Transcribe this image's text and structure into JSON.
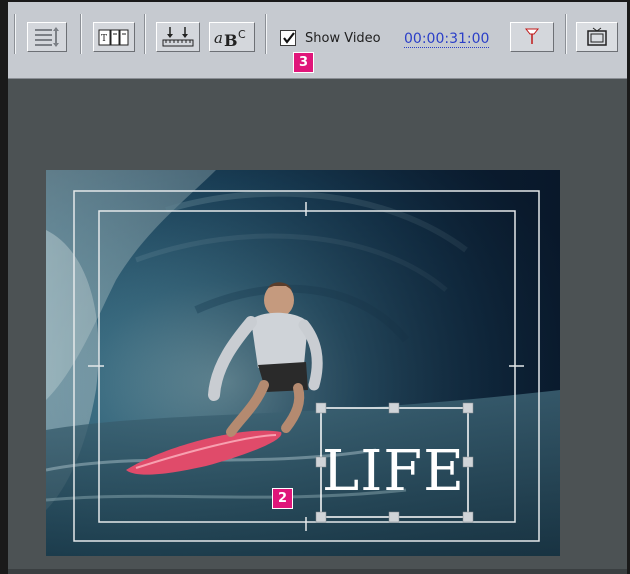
{
  "toolbar": {
    "buttons": [
      {
        "name": "list-view-button",
        "icon": "list-view-icon"
      },
      {
        "name": "insert-text-button",
        "icon": "insert-text-icon"
      },
      {
        "name": "baseline-button",
        "icon": "baseline-align-icon"
      },
      {
        "name": "text-style-button",
        "icon": "text-style-icon",
        "label": "aBC"
      },
      {
        "name": "marker-button",
        "icon": "marker-flag-icon"
      },
      {
        "name": "safe-area-button",
        "icon": "tv-safe-area-icon"
      }
    ],
    "show_video": {
      "label": "Show Video",
      "checked": true
    },
    "timecode": "00:00:31:00"
  },
  "callouts": {
    "toolbar_callout": "3",
    "canvas_callout": "2"
  },
  "canvas": {
    "title_text": "LIFE"
  },
  "colors": {
    "toolbar": "#c6cad0",
    "workspace": "#4c5254",
    "timecode": "#2b3fc8",
    "callout": "#e0167a"
  }
}
